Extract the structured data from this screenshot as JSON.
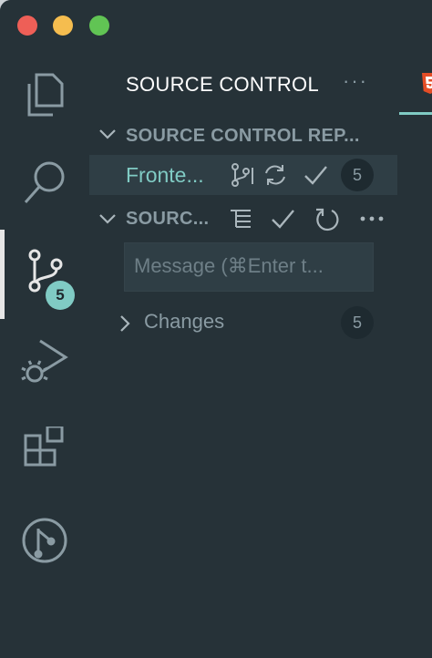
{
  "sidebar": {
    "title": "SOURCE CONTROL",
    "more": "···",
    "repos_section": "SOURCE CONTROL REP...",
    "repo": {
      "name": "Fronte...",
      "count": "5"
    },
    "scm_section": "SOURC...",
    "commit_placeholder": "Message (⌘Enter t...",
    "changes": {
      "label": "Changes",
      "count": "5"
    }
  },
  "activity_bar": {
    "items": [
      "explorer-icon",
      "search-icon",
      "source-control-icon",
      "run-debug-icon",
      "extensions-icon",
      "git-graph-icon"
    ],
    "scm_badge": "5"
  },
  "colors": {
    "accent": "#80cbc4",
    "background": "#263238"
  }
}
